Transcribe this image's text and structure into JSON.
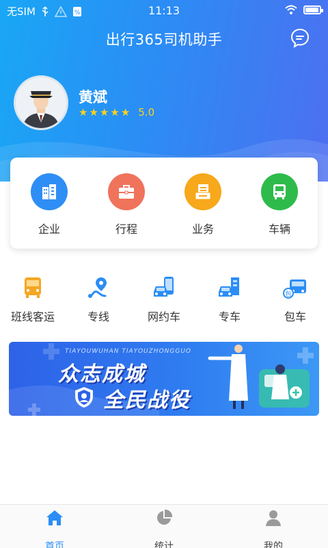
{
  "status_bar": {
    "carrier": "无SIM",
    "time": "11:13",
    "battery_level": 0.85
  },
  "header": {
    "title": "出行365司机助手",
    "message_icon": "chat-bubble-icon"
  },
  "profile": {
    "name": "黄斌",
    "stars": 5,
    "score": "5.0"
  },
  "main_menu": [
    {
      "label": "企业",
      "icon": "building-icon",
      "color": "#2f8ef5"
    },
    {
      "label": "行程",
      "icon": "briefcase-icon",
      "color": "#f0735b"
    },
    {
      "label": "业务",
      "icon": "document-icon",
      "color": "#f7a81b"
    },
    {
      "label": "车辆",
      "icon": "bus-icon",
      "color": "#2fbb4b"
    }
  ],
  "services": [
    {
      "label": "班线客运",
      "icon": "bus-icon"
    },
    {
      "label": "专线",
      "icon": "route-icon"
    },
    {
      "label": "网约车",
      "icon": "phone-car-icon"
    },
    {
      "label": "专车",
      "icon": "special-car-icon"
    },
    {
      "label": "包车",
      "icon": "charter-bus-icon"
    }
  ],
  "banner": {
    "pinyin": "TIAYOUWUHAN TIAYOUZHONGGUO",
    "line1": "众志成城",
    "line2": "全民战役"
  },
  "bottom_nav": [
    {
      "label": "首页",
      "icon": "home-icon",
      "active": true
    },
    {
      "label": "统计",
      "icon": "pie-chart-icon",
      "active": false
    },
    {
      "label": "我的",
      "icon": "user-icon",
      "active": false
    }
  ],
  "colors": {
    "primary": "#2b8df5",
    "star": "#ffd21a"
  }
}
